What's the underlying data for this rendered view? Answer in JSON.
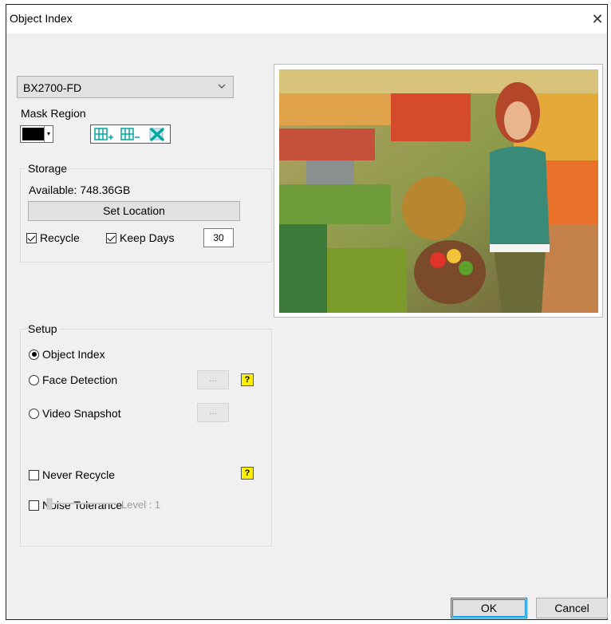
{
  "window": {
    "title": "Object Index",
    "close_glyph": "✕"
  },
  "camera_select": {
    "value": "BX2700-FD"
  },
  "mask_region": {
    "label": "Mask Region",
    "color": "#000000",
    "tools": [
      {
        "icon": "grid-add-icon",
        "color": "#00a99d"
      },
      {
        "icon": "grid-remove-icon",
        "color": "#00a99d"
      },
      {
        "icon": "clear-mask-icon",
        "color": "#00a99d"
      }
    ]
  },
  "storage": {
    "title": "Storage",
    "available": "Available: 748.36GB",
    "set_location_label": "Set Location",
    "recycle_label": "Recycle",
    "recycle_checked": true,
    "keep_days_label": "Keep Days",
    "keep_days_checked": true,
    "keep_days_value": "30"
  },
  "setup": {
    "title": "Setup",
    "options": [
      {
        "label": "Object Index",
        "selected": true
      },
      {
        "label": "Face Detection",
        "selected": false
      },
      {
        "label": "Video Snapshot",
        "selected": false
      }
    ],
    "ellipsis_label": "...",
    "help_glyph": "?",
    "never_recycle_label": "Never Recycle",
    "noise_tolerance_label": "Noise Tolerance",
    "level_label": "Level : 1",
    "noise_level": 1
  },
  "buttons": {
    "ok": "OK",
    "cancel": "Cancel"
  },
  "colors": {
    "accent": "#0078d7",
    "help_badge": "#ffef00",
    "dialog_bg": "#f0f0f0"
  }
}
